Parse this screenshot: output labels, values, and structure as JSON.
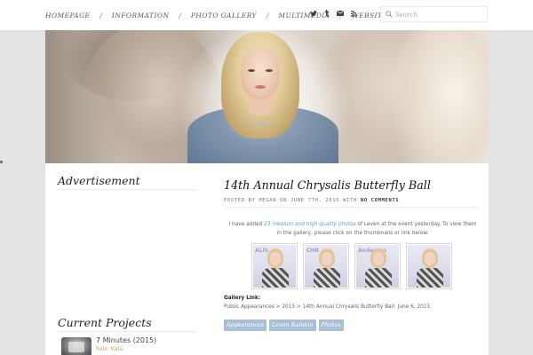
{
  "nav": {
    "items": [
      "Homepage",
      "Information",
      "Photo Gallery",
      "Multimedia",
      "Website"
    ],
    "separator": "/"
  },
  "social": {
    "icons": [
      "twitter-icon",
      "tumblr-icon",
      "mail-icon",
      "rss-icon"
    ]
  },
  "search": {
    "placeholder": "Search"
  },
  "sidebar": {
    "advertisement_title": "Advertisement",
    "current_projects_title": "Current Projects",
    "project": {
      "title": "7 Minutes (2015)",
      "role": "Role: Kate"
    }
  },
  "post": {
    "title": "14th Annual Chrysalis Butterfly Ball",
    "meta_prefix": "Posted by Megan on June 7th, 2015 with",
    "meta_comments": "No Comments",
    "body_before": "I have added",
    "body_link": "23 medium and high quality photos",
    "body_after": "of Leven at the event yesterday. To view them in the gallery, please click on the thumbnails or link below.",
    "gallery_label": "Gallery Link:",
    "breadcrumb": "Public Appearances > 2015 > 14th Annual Chrysalis Butterfly Ball: June 6, 2015",
    "tags": [
      "Appearances",
      "Leven Rambin",
      "Photos"
    ]
  },
  "gallery": {
    "thumbs": [
      {
        "backdrop_text": "ALIS"
      },
      {
        "backdrop_text": "CHR"
      },
      {
        "backdrop_text": "Anderson"
      },
      {
        "backdrop_text": ""
      }
    ]
  },
  "colors": {
    "link": "#5aa6c9",
    "tag_bg": "#a9bfd7",
    "role": "#d7a15a",
    "page_bg": "#e3e3e3"
  }
}
